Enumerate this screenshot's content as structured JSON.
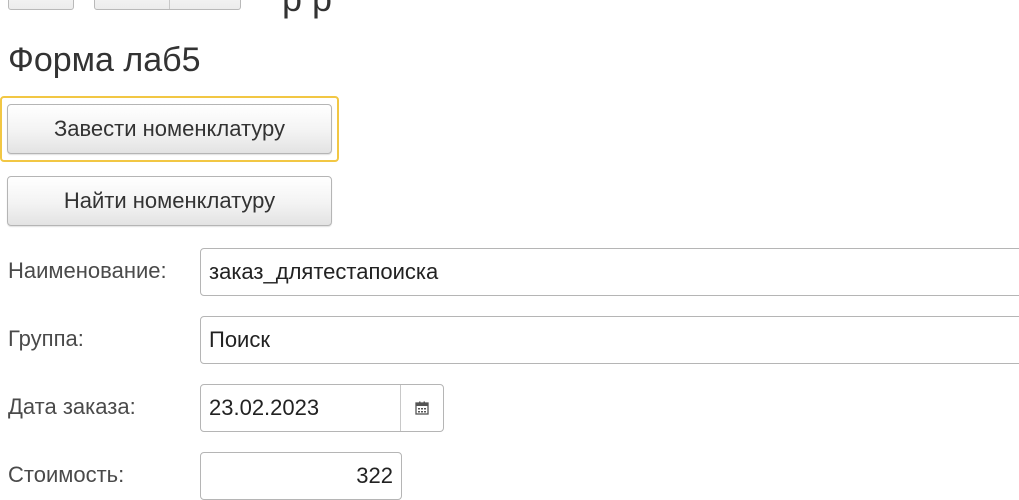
{
  "toolbar": {
    "title_fragment": "р    р"
  },
  "form": {
    "title": "Форма лаб5"
  },
  "buttons": {
    "create_nomenclature": "Завести номенклатуру",
    "find_nomenclature": "Найти номенклатуру"
  },
  "fields": {
    "name": {
      "label": "Наименование:",
      "value": "заказ_длятестапоиска"
    },
    "group": {
      "label": "Группа:",
      "value": "Поиск"
    },
    "order_date": {
      "label": "Дата заказа:",
      "value": "23.02.2023"
    },
    "cost": {
      "label": "Стоимость:",
      "value": "322"
    }
  },
  "icons": {
    "calendar": "calendar-icon"
  },
  "colors": {
    "focus_border": "#f2c744",
    "input_border": "#b5b5b5",
    "text": "#333333"
  }
}
